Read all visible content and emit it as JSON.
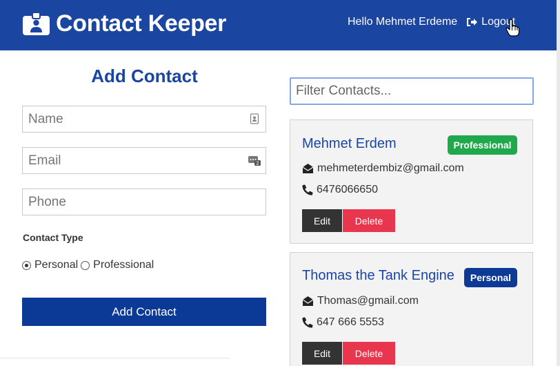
{
  "navbar": {
    "brand_icon": "id-badge-icon",
    "title": "Contact Keeper",
    "greeting": "Hello Mehmet Erdeme",
    "logout_icon": "sign-out-icon",
    "logout_label": "Logout"
  },
  "form": {
    "title": "Add Contact",
    "name_placeholder": "Name",
    "email_placeholder": "Email",
    "phone_placeholder": "Phone",
    "name_icon": "contact-card-icon",
    "email_icon": "password-manager-icon",
    "contact_type_label": "Contact Type",
    "type_options": [
      "Personal",
      "Professional"
    ],
    "selected_type": "Personal",
    "submit_label": "Add Contact"
  },
  "filter": {
    "placeholder": "Filter Contacts..."
  },
  "contacts": [
    {
      "name": "Mehmet Erdem",
      "type": "Professional",
      "email": "mehmeterdembiz@gmail.com",
      "phone": "6476066650",
      "edit_label": "Edit",
      "delete_label": "Delete"
    },
    {
      "name": "Thomas the Tank Engine",
      "type": "Personal",
      "email": "Thomas@gmail.com",
      "phone": "647 666 5553",
      "edit_label": "Edit",
      "delete_label": "Delete"
    }
  ],
  "colors": {
    "navbar": "#1a45a0",
    "primary_button": "#0b3a96",
    "professional_badge": "#1fa94c",
    "personal_badge": "#0c3a96",
    "delete_button": "#e8364e",
    "edit_button": "#333333"
  }
}
